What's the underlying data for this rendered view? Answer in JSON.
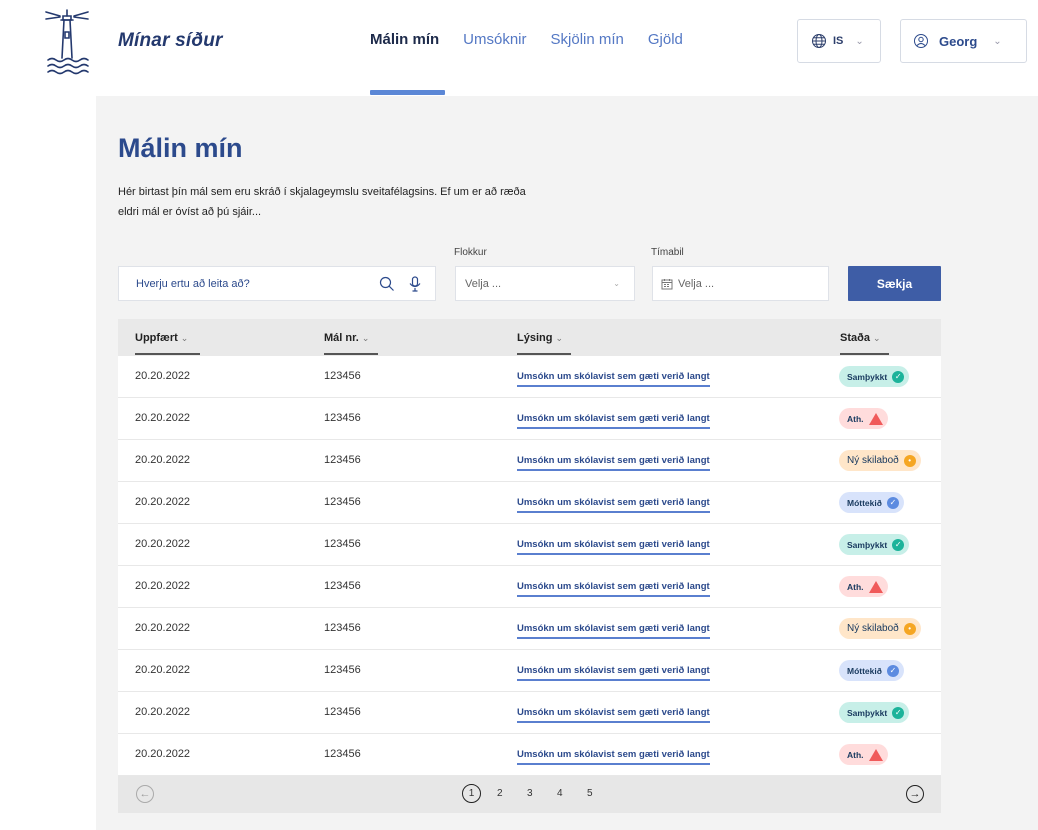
{
  "header": {
    "brand": "Mínar síður",
    "nav": [
      {
        "label": "Málin mín",
        "active": true
      },
      {
        "label": "Umsóknir",
        "active": false
      },
      {
        "label": "Skjölin mín",
        "active": false
      },
      {
        "label": "Gjöld",
        "active": false
      }
    ],
    "language": "IS",
    "user": "Georg"
  },
  "page": {
    "title": "Málin mín",
    "intro": "Hér birtast þín mál sem eru skráð í skjalageymslu sveitafélagsins. Ef um er að ræða eldri mál er óvíst að þú sjáir..."
  },
  "filters": {
    "search_placeholder": "Hverju ertu að leita að?",
    "category_label": "Flokkur",
    "category_value": "Velja ...",
    "period_label": "Tímabil",
    "period_value": "Velja ...",
    "submit_label": "Sækja"
  },
  "table": {
    "columns": [
      "Uppfært",
      "Mál nr.",
      "Lýsing",
      "Staða"
    ],
    "rows": [
      {
        "date": "20.20.2022",
        "case": "123456",
        "desc": "Umsókn um skólavist sem gæti verið langt",
        "status": "Samþykkt",
        "kind": "green"
      },
      {
        "date": "20.20.2022",
        "case": "123456",
        "desc": "Umsókn um skólavist sem gæti verið langt",
        "status": "Ath.",
        "kind": "red"
      },
      {
        "date": "20.20.2022",
        "case": "123456",
        "desc": "Umsókn um skólavist sem gæti verið langt",
        "status": "Ný skilaboð",
        "kind": "orange"
      },
      {
        "date": "20.20.2022",
        "case": "123456",
        "desc": "Umsókn um skólavist sem gæti verið langt",
        "status": "Móttekið",
        "kind": "blue"
      },
      {
        "date": "20.20.2022",
        "case": "123456",
        "desc": "Umsókn um skólavist sem gæti verið langt",
        "status": "Samþykkt",
        "kind": "green"
      },
      {
        "date": "20.20.2022",
        "case": "123456",
        "desc": "Umsókn um skólavist sem gæti verið langt",
        "status": "Ath.",
        "kind": "red"
      },
      {
        "date": "20.20.2022",
        "case": "123456",
        "desc": "Umsókn um skólavist sem gæti verið langt",
        "status": "Ný skilaboð",
        "kind": "orange"
      },
      {
        "date": "20.20.2022",
        "case": "123456",
        "desc": "Umsókn um skólavist sem gæti verið langt",
        "status": "Móttekið",
        "kind": "blue"
      },
      {
        "date": "20.20.2022",
        "case": "123456",
        "desc": "Umsókn um skólavist sem gæti verið langt",
        "status": "Samþykkt",
        "kind": "green"
      },
      {
        "date": "20.20.2022",
        "case": "123456",
        "desc": "Umsókn um skólavist sem gæti verið langt",
        "status": "Ath.",
        "kind": "red"
      }
    ]
  },
  "pagination": {
    "pages": [
      "1",
      "2",
      "3",
      "4",
      "5"
    ],
    "current": "1"
  },
  "colors": {
    "primary": "#3e5da6",
    "heading": "#2c4a8c",
    "nav_link": "#5478c4",
    "background": "#f3f3f3"
  }
}
